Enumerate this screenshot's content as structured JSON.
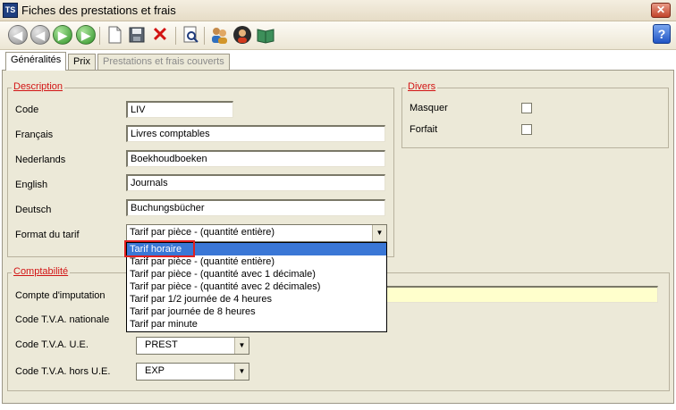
{
  "window": {
    "title": "Fiches des prestations et frais",
    "app_icon": "TS",
    "close_glyph": "✕"
  },
  "toolbar": {
    "buttons": [
      {
        "name": "first-record-icon",
        "glyph": "◀"
      },
      {
        "name": "previous-record-icon",
        "glyph": "◀"
      },
      {
        "name": "next-record-icon",
        "glyph": "▶"
      },
      {
        "name": "last-record-icon",
        "glyph": "▶"
      },
      {
        "name": "new-document-icon",
        "glyph": ""
      },
      {
        "name": "save-icon",
        "glyph": ""
      },
      {
        "name": "delete-icon",
        "glyph": "✕"
      },
      {
        "name": "preview-icon",
        "glyph": ""
      },
      {
        "name": "users-icon",
        "glyph": ""
      },
      {
        "name": "user-icon",
        "glyph": ""
      },
      {
        "name": "book-icon",
        "glyph": ""
      }
    ],
    "help_glyph": "?"
  },
  "tabs": [
    "Généralités",
    "Prix",
    "Prestations et frais couverts"
  ],
  "description": {
    "legend": "Description",
    "code_label": "Code",
    "code_value": "LIV",
    "fr_label": "Français",
    "fr_value": "Livres comptables",
    "nl_label": "Nederlands",
    "nl_value": "Boekhoudboeken",
    "en_label": "English",
    "en_value": "Journals",
    "de_label": "Deutsch",
    "de_value": "Buchungsbücher",
    "format_label": "Format du tarif",
    "format_value": "Tarif par pièce - (quantité entière)"
  },
  "divers": {
    "legend": "Divers",
    "masquer_label": "Masquer",
    "forfait_label": "Forfait"
  },
  "comptabilite": {
    "legend": "Comptabilité",
    "compte_label": "Compte d'imputation",
    "tva_nat_label": "Code T.V.A. nationale",
    "tva_ue_label": "Code T.V.A. U.E.",
    "tva_ue_value": "PREST",
    "tva_hors_label": "Code T.V.A. hors U.E.",
    "tva_hors_value": "EXP"
  },
  "dropdown": {
    "options": [
      "Tarif horaire",
      "Tarif par pièce - (quantité entière)",
      "Tarif par pièce - (quantité avec 1 décimale)",
      "Tarif par pièce - (quantité avec 2 décimales)",
      "Tarif par 1/2 journée de 4 heures",
      "Tarif par journée de 8 heures",
      "Tarif par minute"
    ],
    "highlighted": "Tarif horaire"
  },
  "colors": {
    "legend_red": "#d21414",
    "panel_bg": "#ece9d8",
    "selection_blue": "#3a77d6",
    "accent_field": "#ffffcc"
  }
}
